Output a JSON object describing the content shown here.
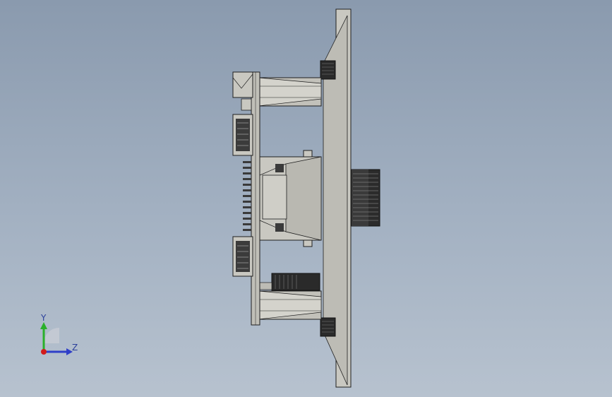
{
  "triad": {
    "y_label": "Y",
    "z_label": "Z"
  },
  "colors": {
    "background_top": "#8a9aae",
    "background_bottom": "#b7c2cf",
    "part_fill": "#c5c4bd",
    "part_shade": "#a9a8a1",
    "edge": "#1f1f1f",
    "axis_y": "#2ab02a",
    "axis_z": "#2f3fc8",
    "axis_x": "#d21b1b"
  }
}
